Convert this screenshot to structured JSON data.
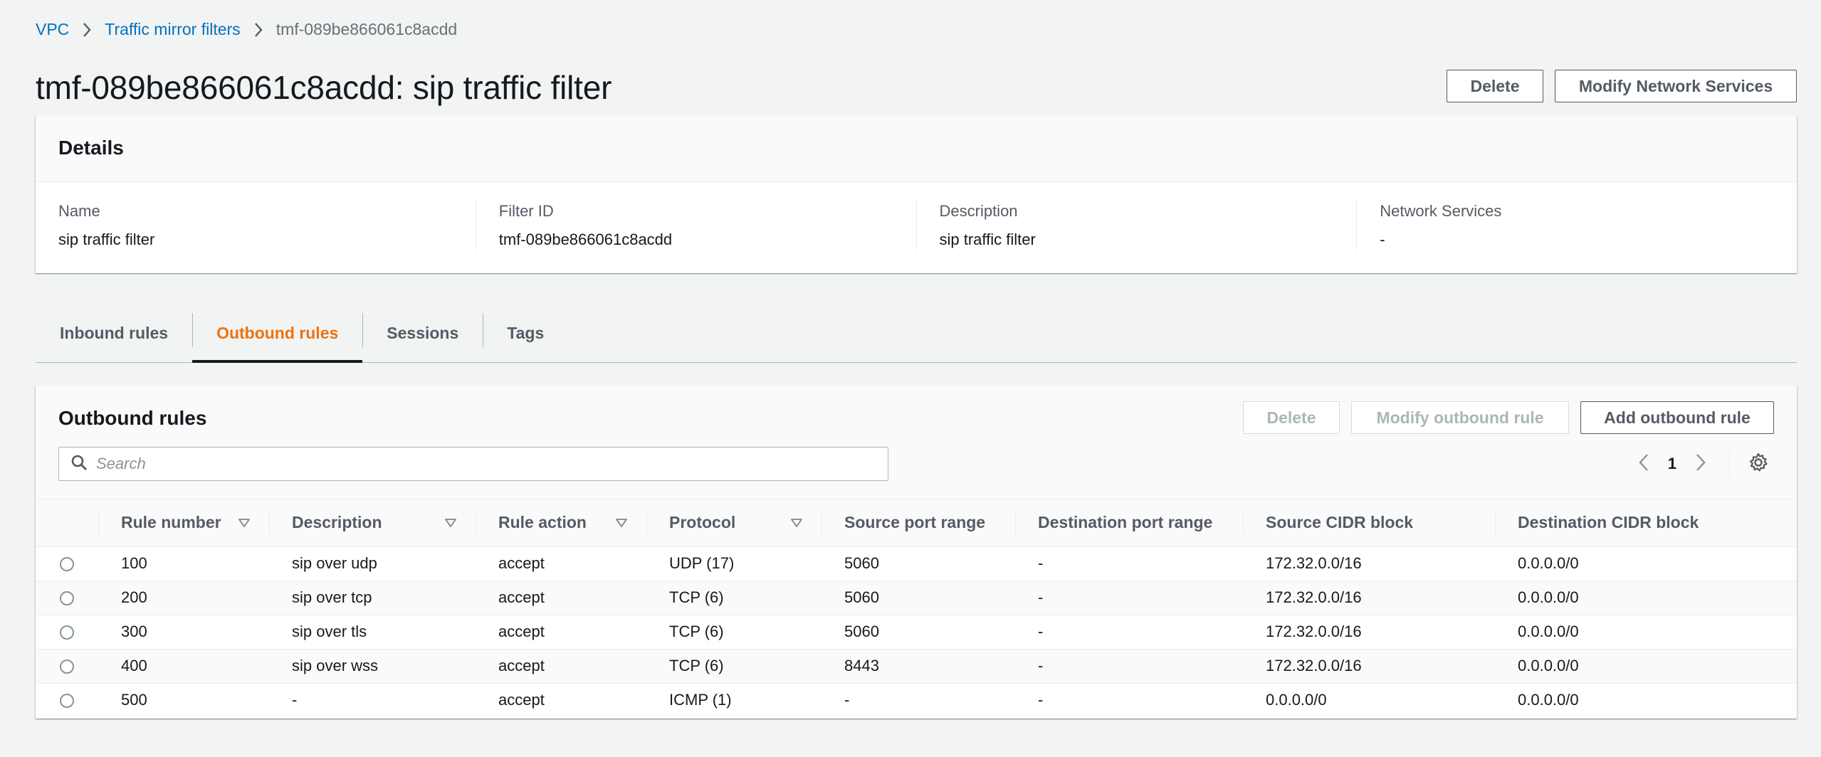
{
  "breadcrumb": {
    "items": [
      "VPC",
      "Traffic mirror filters"
    ],
    "current": "tmf-089be866061c8acdd"
  },
  "header": {
    "title": "tmf-089be866061c8acdd: sip traffic filter",
    "delete_label": "Delete",
    "modify_label": "Modify Network Services"
  },
  "details": {
    "title": "Details",
    "fields": [
      {
        "label": "Name",
        "value": "sip traffic filter"
      },
      {
        "label": "Filter ID",
        "value": "tmf-089be866061c8acdd"
      },
      {
        "label": "Description",
        "value": "sip traffic filter"
      },
      {
        "label": "Network Services",
        "value": "-"
      }
    ]
  },
  "tabs": [
    {
      "label": "Inbound rules",
      "active": false
    },
    {
      "label": "Outbound rules",
      "active": true
    },
    {
      "label": "Sessions",
      "active": false
    },
    {
      "label": "Tags",
      "active": false
    }
  ],
  "rules": {
    "title": "Outbound rules",
    "delete_label": "Delete",
    "modify_label": "Modify outbound rule",
    "add_label": "Add outbound rule",
    "search_placeholder": "Search",
    "page": "1",
    "columns": [
      "Rule number",
      "Description",
      "Rule action",
      "Protocol",
      "Source port range",
      "Destination port range",
      "Source CIDR block",
      "Destination CIDR block"
    ],
    "rows": [
      [
        "100",
        "sip over udp",
        "accept",
        "UDP (17)",
        "5060",
        "-",
        "172.32.0.0/16",
        "0.0.0.0/0"
      ],
      [
        "200",
        "sip over tcp",
        "accept",
        "TCP (6)",
        "5060",
        "-",
        "172.32.0.0/16",
        "0.0.0.0/0"
      ],
      [
        "300",
        "sip over tls",
        "accept",
        "TCP (6)",
        "5060",
        "-",
        "172.32.0.0/16",
        "0.0.0.0/0"
      ],
      [
        "400",
        "sip over wss",
        "accept",
        "TCP (6)",
        "8443",
        "-",
        "172.32.0.0/16",
        "0.0.0.0/0"
      ],
      [
        "500",
        "-",
        "accept",
        "ICMP (1)",
        "-",
        "-",
        "0.0.0.0/0",
        "0.0.0.0/0"
      ]
    ]
  },
  "colors": {
    "link": "#0073bb",
    "active_tab": "#ec7211",
    "text": "#16191f",
    "muted": "#545b64"
  }
}
